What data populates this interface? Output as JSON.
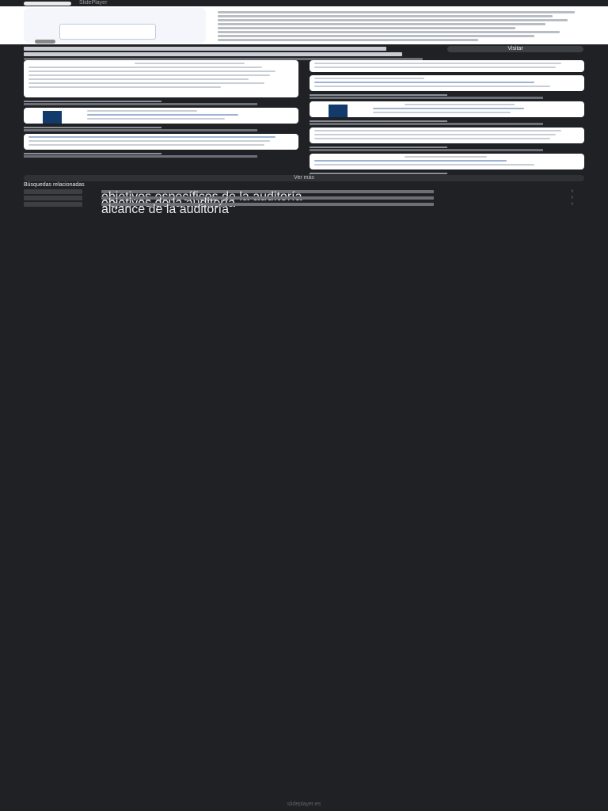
{
  "header": {
    "brand": "SlidePlayer"
  },
  "actions": {
    "visit_label": "Visitar",
    "more_label": "Ver más"
  },
  "related": {
    "heading": "Búsquedas relacionadas",
    "items": [
      {
        "label": "objetivos específicos de la auditoría"
      },
      {
        "label": "objetivos de la auditoría"
      },
      {
        "label": "alcance de la auditoría"
      }
    ]
  },
  "footer": {
    "domain": "slideplayer.es"
  }
}
